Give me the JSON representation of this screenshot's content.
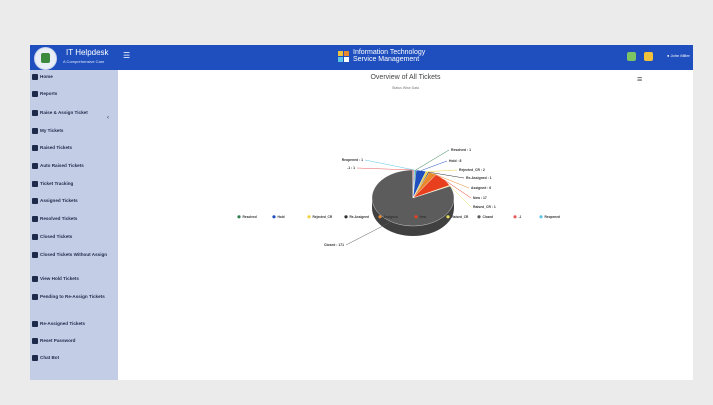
{
  "header": {
    "app_title": "IT Helpdesk",
    "app_subtitle": "A Comprehensive Care",
    "center_title_line1": "Information Technology",
    "center_title_line2": "Service Management",
    "user": "John Miller"
  },
  "sidebar": {
    "items": [
      {
        "label": "Home",
        "icon": "home-icon"
      },
      {
        "label": "Reports",
        "icon": "list-icon"
      },
      {
        "label": "Raise & Assign Ticket",
        "icon": "ticket-icon"
      },
      {
        "label": "My Tickets",
        "icon": "id-card-icon"
      },
      {
        "label": "Raised Tickets",
        "icon": "warning-icon"
      },
      {
        "label": "Auto Raised Tickets",
        "icon": "robot-icon"
      },
      {
        "label": "Ticket Tracking",
        "icon": "location-icon"
      },
      {
        "label": "Assigned Tickets",
        "icon": "users-icon"
      },
      {
        "label": "Resolved Tickets",
        "icon": "user-check-icon"
      },
      {
        "label": "Closed Tickets",
        "icon": "close-box-icon"
      },
      {
        "label": "Closed Tickets Without Assign",
        "icon": "hourglass-icon"
      },
      {
        "label": "View Hold Tickets",
        "icon": "car-icon"
      },
      {
        "label": "Pending to Re-Assign Tickets",
        "icon": "hourglass-icon"
      },
      {
        "label": "Re-Assigned Tickets",
        "icon": "swap-icon"
      },
      {
        "label": "Reset Password",
        "icon": "key-icon"
      },
      {
        "label": "Chat Bot",
        "icon": "chat-icon"
      }
    ]
  },
  "chart_data": {
    "type": "pie",
    "title": "Overview of All Tickets",
    "subtitle": "Status Wise Data",
    "categories": [
      "Resolved",
      "Hold",
      "Rejected_CR",
      "Re-Assigned",
      "Assigned",
      "New",
      "Raised_CR",
      "Closed",
      "-1",
      "Reopened"
    ],
    "values": [
      1,
      8,
      2,
      1,
      6,
      17,
      1,
      171,
      1,
      1
    ],
    "colors": [
      "#2f7d4f",
      "#1f4fbf",
      "#f0d23c",
      "#2f2f2f",
      "#e8882c",
      "#e8401f",
      "#e8e05c",
      "#5c5c5c",
      "#e85c5c",
      "#5cc4e8"
    ],
    "data_labels": [
      {
        "name": "Resolved",
        "text": "Resolved : 1"
      },
      {
        "name": "Hold",
        "text": "Hold : 8"
      },
      {
        "name": "Rejected_CR",
        "text": "Rejected_CR : 2"
      },
      {
        "name": "Re-Assigned",
        "text": "Re-Assigned : 1"
      },
      {
        "name": "Assigned",
        "text": "Assigned : 6"
      },
      {
        "name": "New",
        "text": "New : 17"
      },
      {
        "name": "Raised_CR",
        "text": "Raised_CR : 1"
      },
      {
        "name": "Closed",
        "text": "Closed : 171"
      },
      {
        "name": "-1",
        "text": "-1 : 1"
      },
      {
        "name": "Reopened",
        "text": "Reopened : 1"
      }
    ],
    "legend_position": "bottom"
  }
}
